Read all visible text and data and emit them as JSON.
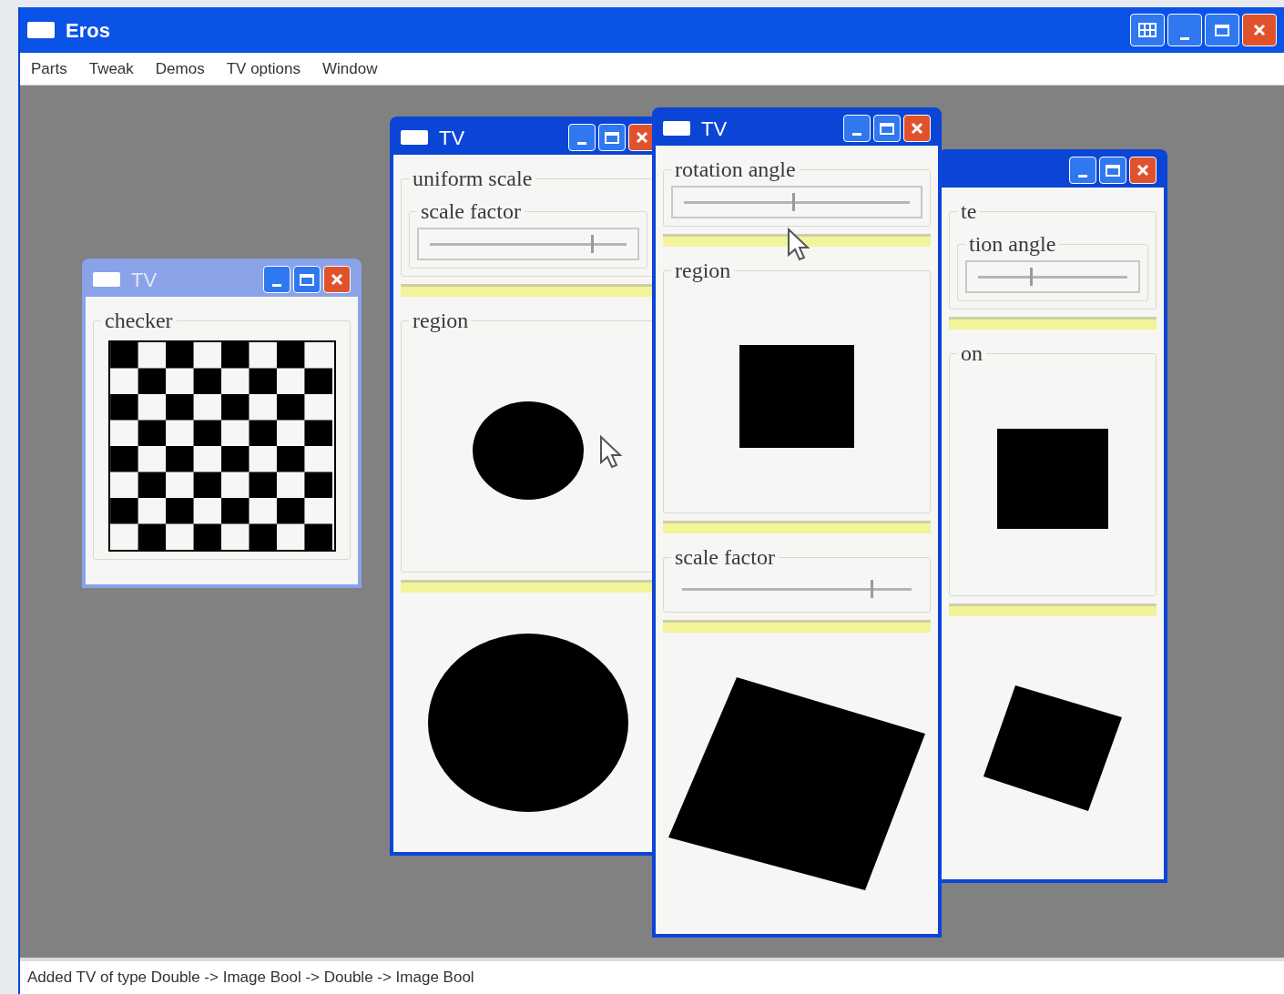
{
  "app": {
    "title": "Eros"
  },
  "menu": [
    "Parts",
    "Tweak",
    "Demos",
    "TV options",
    "Window"
  ],
  "windows": [
    {
      "title": "TV",
      "active": false,
      "parts": [
        {
          "kind": "group",
          "label": "checker",
          "children": [
            {
              "kind": "checker"
            }
          ]
        }
      ]
    },
    {
      "title": "TV",
      "active": true,
      "parts": [
        {
          "kind": "group",
          "label": "uniform scale",
          "children": [
            {
              "kind": "group",
              "label": "scale factor",
              "children": [
                {
                  "kind": "slider",
                  "framed": true,
                  "level": 0.82
                }
              ]
            }
          ]
        },
        {
          "kind": "bar"
        },
        {
          "kind": "group",
          "label": "region",
          "children": [
            {
              "kind": "circle"
            }
          ]
        },
        {
          "kind": "bar"
        },
        {
          "kind": "bigcircle"
        }
      ]
    },
    {
      "title": "TV",
      "active": true,
      "parts": [
        {
          "kind": "group",
          "label": "rotation angle",
          "children": [
            {
              "kind": "slider",
              "framed": true,
              "level": 0.48
            }
          ]
        },
        {
          "kind": "bar"
        },
        {
          "kind": "group",
          "label": "region",
          "children": [
            {
              "kind": "square"
            }
          ]
        },
        {
          "kind": "bar"
        },
        {
          "kind": "group",
          "label": "scale factor",
          "children": [
            {
              "kind": "slider",
              "framed": false,
              "level": 0.82
            }
          ]
        },
        {
          "kind": "bar"
        },
        {
          "kind": "diamond"
        }
      ]
    },
    {
      "active": true,
      "parts": [
        {
          "kind": "group",
          "label": "te",
          "children": [
            {
              "kind": "group",
              "label": "tion angle",
              "children": [
                {
                  "kind": "slider",
                  "framed": true,
                  "level": 0.35
                }
              ]
            }
          ]
        },
        {
          "kind": "bar"
        },
        {
          "kind": "group",
          "label": "on",
          "children": [
            {
              "kind": "smallsquare"
            }
          ]
        },
        {
          "kind": "bar"
        },
        {
          "kind": "smalldiamond"
        }
      ]
    }
  ],
  "status_bar": "Added TV of type Double -> Image Bool -> Double -> Image Bool"
}
